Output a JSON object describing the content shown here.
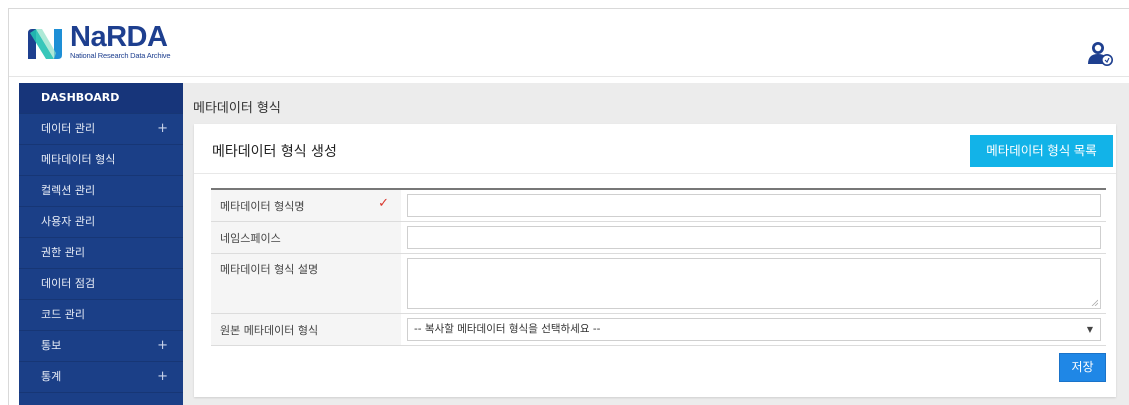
{
  "brand": {
    "name": "NaRDA",
    "tagline": "National Research Data Archive",
    "colors": {
      "navy": "#1e3f8f",
      "teal": "#16c2b0",
      "accent": "#12b3e8"
    }
  },
  "header": {
    "user_icon": "user-settings-icon"
  },
  "sidebar": {
    "items": [
      {
        "label": "DASHBOARD",
        "plus": ""
      },
      {
        "label": "데이터 관리",
        "plus": "+"
      },
      {
        "label": "메타데이터 형식",
        "plus": ""
      },
      {
        "label": "컬렉션 관리",
        "plus": ""
      },
      {
        "label": "사용자 관리",
        "plus": ""
      },
      {
        "label": "권한 관리",
        "plus": ""
      },
      {
        "label": "데이터 점검",
        "plus": ""
      },
      {
        "label": "코드 관리",
        "plus": ""
      },
      {
        "label": "통보",
        "plus": "+"
      },
      {
        "label": "통계",
        "plus": "+"
      }
    ]
  },
  "main": {
    "breadcrumb": "메타데이터 형식",
    "card_title": "메타데이터 형식 생성",
    "list_button": "메타데이터 형식 목록",
    "save_button": "저장",
    "form": {
      "name_label": "메타데이터 형식명",
      "name_value": "",
      "namespace_label": "네임스페이스",
      "namespace_value": "",
      "desc_label": "메타데이터 형식 설명",
      "desc_value": "",
      "source_label": "원본 메타데이터 형식",
      "source_selected": "-- 복사할 메타데이터 형식을 선택하세요 --"
    }
  }
}
